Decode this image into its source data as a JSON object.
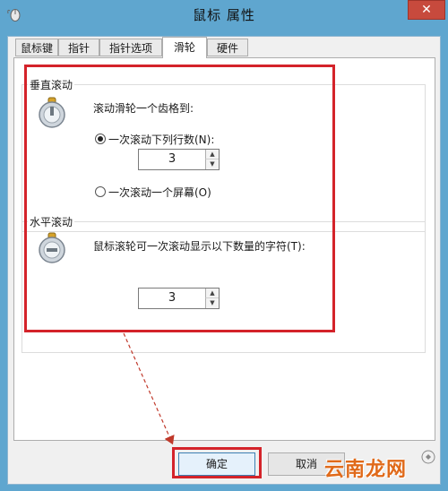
{
  "window": {
    "title": "鼠标 属性",
    "close_label": "✕"
  },
  "tabs": [
    {
      "label": "鼠标键",
      "active": false
    },
    {
      "label": "指针",
      "active": false
    },
    {
      "label": "指针选项",
      "active": false
    },
    {
      "label": "滑轮",
      "active": true
    },
    {
      "label": "硬件",
      "active": false
    }
  ],
  "vertical_scroll": {
    "group_label": "垂直滚动",
    "description": "滚动滑轮一个齿格到:",
    "option_lines_label": "一次滚动下列行数(N):",
    "option_lines_checked": true,
    "lines_value": "3",
    "option_screen_label": "一次滚动一个屏幕(O)",
    "option_screen_checked": false
  },
  "horizontal_scroll": {
    "group_label": "水平滚动",
    "description": "鼠标滚轮可一次滚动显示以下数量的字符(T):",
    "chars_value": "3"
  },
  "buttons": {
    "ok": "确定",
    "cancel": "取消"
  },
  "watermark": "云南龙网",
  "colors": {
    "highlight": "#d4232a",
    "window_frame": "#5fa6cf",
    "close_button": "#c74a3d"
  }
}
